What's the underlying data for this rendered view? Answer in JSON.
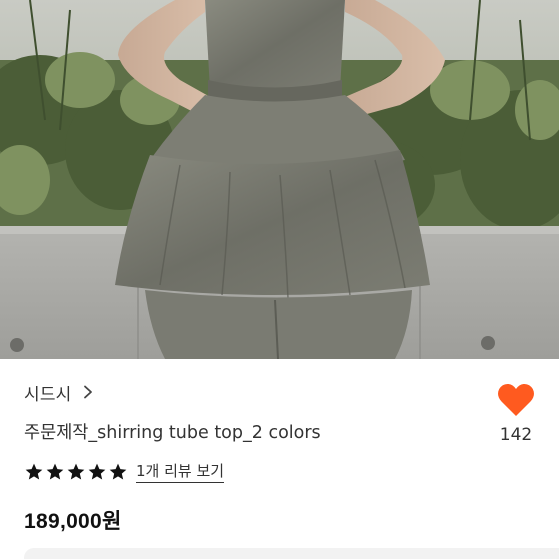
{
  "product_image": {
    "alt": "",
    "icon": "product-photo"
  },
  "shop": {
    "name": "시드시",
    "chevron_icon": "chevron-right-icon"
  },
  "product": {
    "title": "주문제작_shirring tube top_2 colors",
    "price": "189,000원"
  },
  "reviews": {
    "rating": 5,
    "max_rating": 5,
    "link_label": "1개 리뷰 보기"
  },
  "like": {
    "count": "142",
    "icon": "heart-icon",
    "color": "#ff5a1f"
  },
  "colors": {
    "accent": "#ff5a1f",
    "star": "#111111"
  }
}
